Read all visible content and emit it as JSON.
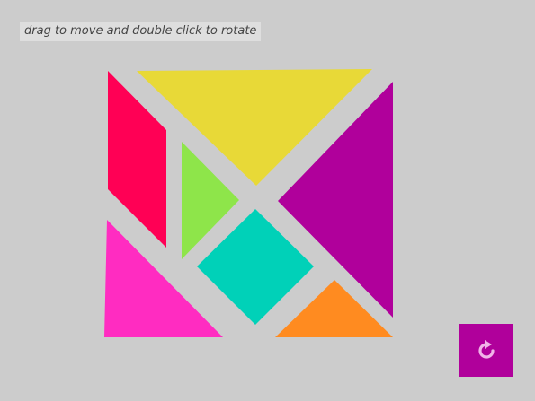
{
  "hint": {
    "text": "drag to move and double click to rotate"
  },
  "pieces": [
    {
      "id": "large-triangle-top",
      "shape": "large triangle",
      "color": "#e8d937"
    },
    {
      "id": "large-triangle-right",
      "shape": "large triangle",
      "color": "#b0009b"
    },
    {
      "id": "parallelogram",
      "shape": "parallelogram",
      "color": "#ff0055"
    },
    {
      "id": "small-triangle-green",
      "shape": "small triangle",
      "color": "#8ee54a"
    },
    {
      "id": "square",
      "shape": "square",
      "color": "#00d1b8"
    },
    {
      "id": "medium-triangle",
      "shape": "medium triangle",
      "color": "#ff2cc1"
    },
    {
      "id": "small-triangle-orange",
      "shape": "small triangle",
      "color": "#ff8b20"
    }
  ],
  "reset": {
    "icon": "rotate-cw-icon",
    "color": "#b0009b"
  }
}
